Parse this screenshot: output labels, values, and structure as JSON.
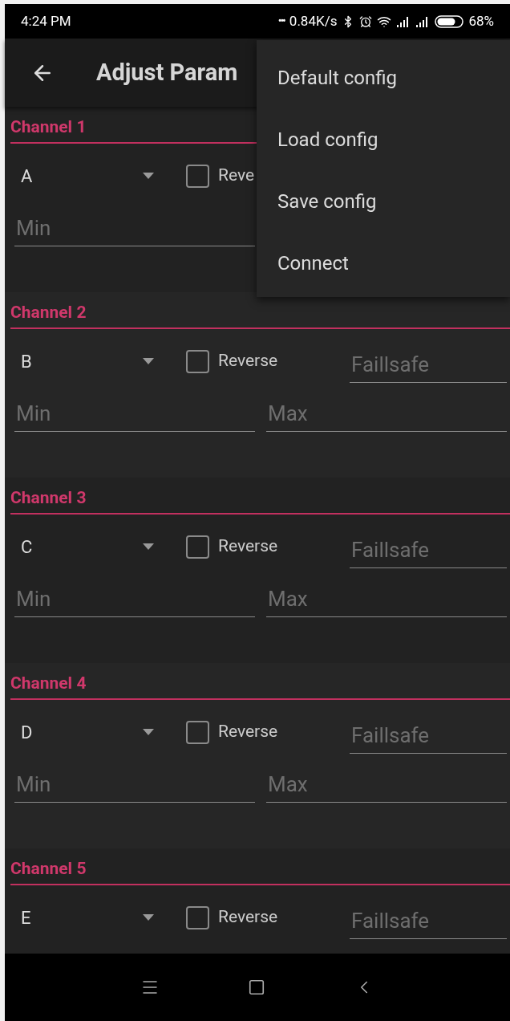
{
  "status_bar": {
    "time": "4:24 PM",
    "dots": "•••",
    "speed": "0.84K/s",
    "battery": "68%"
  },
  "app_bar": {
    "title": "Adjust Param"
  },
  "channels": [
    {
      "title": "Channel 1",
      "selector": {
        "value": "A"
      },
      "reverse": {
        "label": "Reve",
        "checked": false
      },
      "min": {
        "placeholder": "Min"
      }
    },
    {
      "title": "Channel 2",
      "selector": {
        "value": "B"
      },
      "reverse": {
        "label": "Reverse",
        "checked": false
      },
      "failsafe": {
        "placeholder": "Faillsafe"
      },
      "min": {
        "placeholder": "Min"
      },
      "max": {
        "placeholder": "Max"
      }
    },
    {
      "title": "Channel 3",
      "selector": {
        "value": "C"
      },
      "reverse": {
        "label": "Reverse",
        "checked": false
      },
      "failsafe": {
        "placeholder": "Faillsafe"
      },
      "min": {
        "placeholder": "Min"
      },
      "max": {
        "placeholder": "Max"
      }
    },
    {
      "title": "Channel 4",
      "selector": {
        "value": "D"
      },
      "reverse": {
        "label": "Reverse",
        "checked": false
      },
      "failsafe": {
        "placeholder": "Faillsafe"
      },
      "min": {
        "placeholder": "Min"
      },
      "max": {
        "placeholder": "Max"
      }
    },
    {
      "title": "Channel 5",
      "selector": {
        "value": "E"
      },
      "reverse": {
        "label": "Reverse",
        "checked": false
      },
      "failsafe": {
        "placeholder": "Faillsafe"
      }
    }
  ],
  "menu": {
    "items": [
      "Default config",
      "Load config",
      "Save config",
      "Connect"
    ]
  }
}
